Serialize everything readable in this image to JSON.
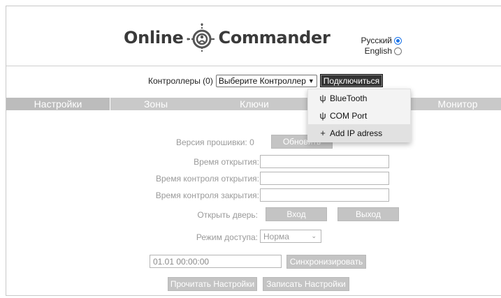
{
  "header": {
    "logo_left": "Online",
    "logo_right": "Commander",
    "languages": [
      {
        "label": "Русский",
        "selected": true
      },
      {
        "label": "English",
        "selected": false
      }
    ]
  },
  "controllers": {
    "label": "Контроллеры (0)",
    "select_value": "Выберите Контроллер",
    "connect_label": "Подключиться"
  },
  "tabs": [
    "Настройки",
    "Зоны",
    "Ключи",
    "",
    "Монитор"
  ],
  "connect_menu": [
    {
      "icon": "usb-icon",
      "label": "BlueTooth"
    },
    {
      "icon": "usb-icon",
      "label": "COM Port"
    },
    {
      "icon": "plus-icon",
      "label": "Add IP adress"
    }
  ],
  "settings": {
    "firmware_label": "Версия прошивки:",
    "firmware_value": "0",
    "update_label": "Обновить",
    "open_time_label": "Время открытия:",
    "open_control_label": "Время контроля открытия:",
    "close_control_label": "Время контроля закрытия:",
    "open_door_label": "Открыть дверь:",
    "enter_label": "Вход",
    "exit_label": "Выход",
    "access_mode_label": "Режим доступа:",
    "access_mode_value": "Норма",
    "datetime_value": "01.01 00:00:00",
    "sync_label": "Синхронизировать",
    "read_label": "Прочитать Настройки",
    "write_label": "Записать Настройки"
  },
  "colors": {
    "accent_radio": "#1a73e8",
    "tab_bg": "#c9c9c9",
    "button_dark": "#333333",
    "button_grey": "#c4c4c4"
  }
}
